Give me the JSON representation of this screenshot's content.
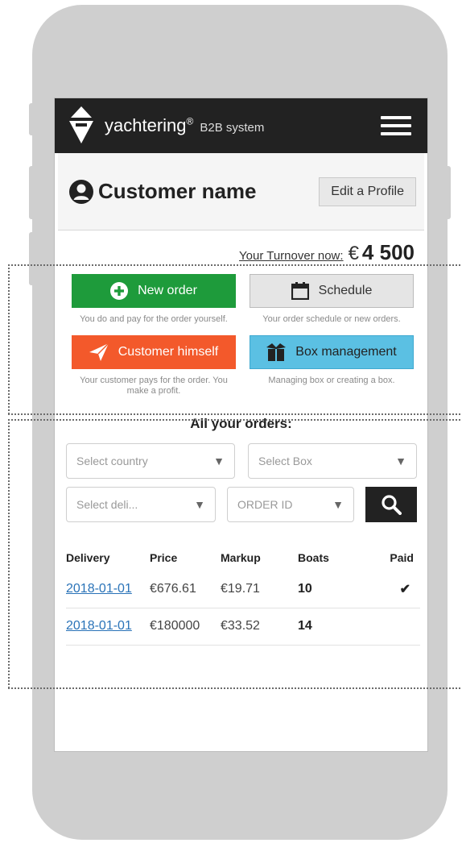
{
  "header": {
    "brand": "yachtering",
    "reg_mark": "®",
    "subtitle": "B2B system"
  },
  "profile": {
    "name": "Customer name",
    "edit_label": "Edit a Profile"
  },
  "turnover": {
    "label": "Your Turnover now:",
    "currency": "€",
    "value": "4 500"
  },
  "actions": {
    "new_order": {
      "label": "New order",
      "desc": "You do and pay for the order yourself."
    },
    "schedule": {
      "label": "Schedule",
      "desc": "Your order schedule or new orders."
    },
    "customer_himself": {
      "label": "Customer himself",
      "desc": "Your customer pays for the order. You make a profit."
    },
    "box_management": {
      "label": "Box management",
      "desc": "Managing box or creating a box."
    }
  },
  "orders": {
    "title": "All your orders:",
    "filters": {
      "country": "Select country",
      "box": "Select Box",
      "delivery": "Select deli...",
      "order_id": "ORDER ID"
    },
    "columns": [
      "Delivery",
      "Price",
      "Markup",
      "Boats",
      "Paid"
    ],
    "rows": [
      {
        "delivery": "2018-01-01",
        "price": "€676.61",
        "markup": "€19.71",
        "boats": "10",
        "paid": "✔"
      },
      {
        "delivery": "2018-01-01",
        "price": "€180000",
        "markup": "€33.52",
        "boats": "14",
        "paid": ""
      }
    ]
  },
  "colors": {
    "header_bg": "#222222",
    "green": "#1e9b3b",
    "orange": "#f3592b",
    "blue": "#5bc0e3",
    "link": "#2a73b8"
  },
  "icons": {
    "logo": "yacht-logo-icon",
    "menu": "hamburger-menu-icon",
    "avatar": "user-avatar-icon",
    "new_order": "plus-circle-icon",
    "schedule": "calendar-icon",
    "customer_himself": "paper-plane-icon",
    "box_management": "box-icon",
    "search": "search-icon",
    "paid": "checkmark-icon"
  }
}
